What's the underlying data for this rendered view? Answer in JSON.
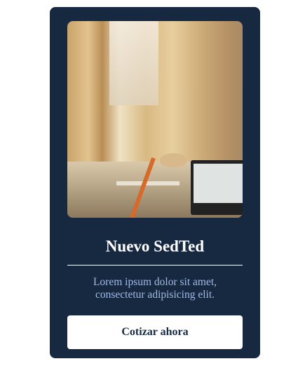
{
  "card": {
    "image_alt": "office desk with lamp and monitor",
    "title": "Nuevo SedTed",
    "description": "Lorem ipsum dolor sit amet, consectetur adipisicing elit.",
    "button_label": "Cotizar ahora"
  },
  "colors": {
    "card_bg": "#172841",
    "description": "#9fbbe8",
    "button_bg": "#ffffff",
    "button_text": "#172841"
  }
}
